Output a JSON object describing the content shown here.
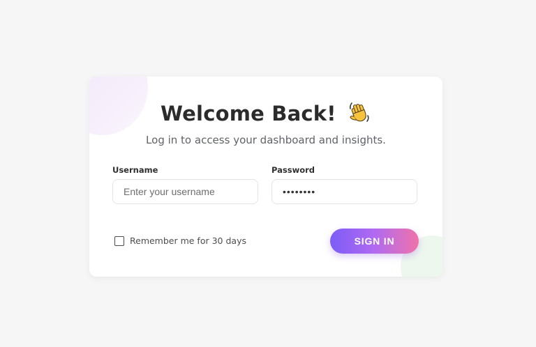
{
  "card": {
    "title": "Welcome Back!",
    "title_icon": "waving-hand-icon",
    "subtitle": "Log in to access your dashboard and insights."
  },
  "username": {
    "label": "Username",
    "placeholder": "Enter your username",
    "value": ""
  },
  "password": {
    "label": "Password",
    "value": "••••••••"
  },
  "remember": {
    "label": "Remember me for 30 days",
    "checked": false
  },
  "signin": {
    "label": "SIGN IN"
  },
  "colors": {
    "accent_start": "#7c5cf7",
    "accent_end": "#ef73a9",
    "background": "#f6f6f7",
    "card": "#ffffff"
  }
}
